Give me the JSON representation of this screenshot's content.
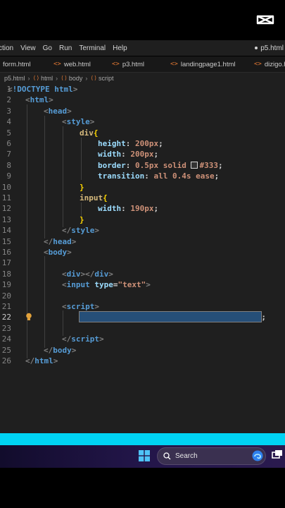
{
  "menubar": {
    "items": [
      "ction",
      "View",
      "Go",
      "Run",
      "Terminal",
      "Help"
    ],
    "right_title": "p5.html"
  },
  "tabs": [
    {
      "label": "form.html"
    },
    {
      "label": "web.html"
    },
    {
      "label": "p3.html"
    },
    {
      "label": "landingpage1.html"
    },
    {
      "label": "dizigo.h"
    }
  ],
  "breadcrumb": [
    "p5.html",
    "html",
    "body",
    "script"
  ],
  "editor": {
    "line_numbers": [
      "1",
      "2",
      "3",
      "4",
      "5",
      "6",
      "7",
      "8",
      "9",
      "10",
      "11",
      "12",
      "13",
      "14",
      "15",
      "16",
      "17",
      "18",
      "19",
      "20",
      "21",
      "22",
      "23",
      "24",
      "25",
      "26"
    ],
    "active_line": "22",
    "color_value": "#333"
  },
  "taskbar": {
    "search_label": "Search"
  },
  "colors": {
    "editor_bg": "#1f1f1f",
    "accent_cyan": "#00d3f3",
    "selection": "#264f78",
    "tag_blue": "#569cd6",
    "selector_gold": "#d7ba7d",
    "property_lightblue": "#9cdcfe",
    "value_orange": "#ce9178"
  },
  "icons": [
    "capcut-logo-icon",
    "html-file-icon",
    "lightbulb-icon",
    "windows-start-icon",
    "search-icon",
    "copilot-icon"
  ]
}
